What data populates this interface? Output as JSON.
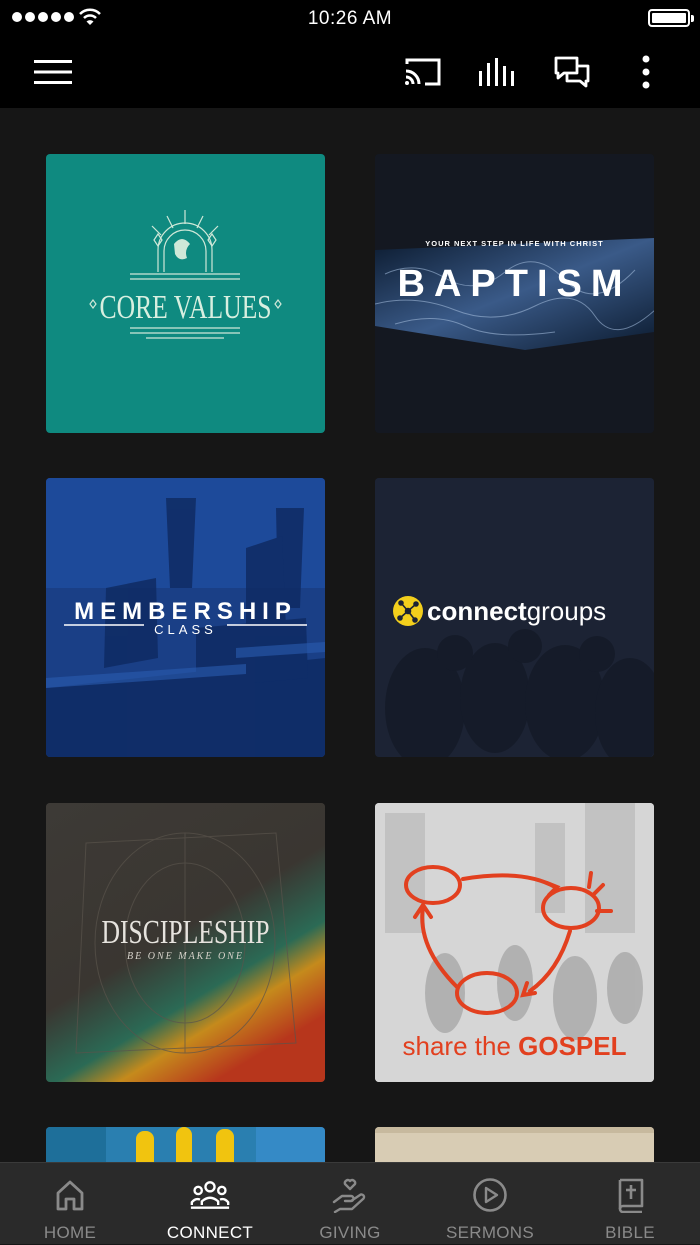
{
  "status_bar": {
    "time": "10:26 AM"
  },
  "toolbar": {
    "menu_icon": "hamburger-icon",
    "cast_icon": "cast-icon",
    "stats_icon": "bars-icon",
    "chat_icon": "chat-icon",
    "more_icon": "vertical-dots-icon"
  },
  "tiles": [
    {
      "title": "CORE VALUES",
      "color": "#0f8a80"
    },
    {
      "subtitle": "YOUR NEXT STEP IN LIFE WITH CHRIST",
      "title": "BAPTISM",
      "color": "#151a24"
    },
    {
      "title": "MEMBERSHIP",
      "subtitle": "CLASS",
      "color": "#173a7e"
    },
    {
      "title_bold": "connect",
      "title_light": "groups",
      "color": "#1e2535"
    },
    {
      "title": "DISCIPLESHIP",
      "subtitle": "BE ONE MAKE ONE",
      "color": "#3a3530"
    },
    {
      "title_light": "share the ",
      "title_bold": "GOSPEL",
      "color": "#d9d9d9",
      "accent": "#e2401f"
    }
  ],
  "tabs": [
    {
      "label": "HOME",
      "icon": "home-icon",
      "active": false
    },
    {
      "label": "CONNECT",
      "icon": "people-icon",
      "active": true
    },
    {
      "label": "GIVING",
      "icon": "giving-hand-icon",
      "active": false
    },
    {
      "label": "SERMONS",
      "icon": "play-circle-icon",
      "active": false
    },
    {
      "label": "BIBLE",
      "icon": "bible-icon",
      "active": false
    }
  ]
}
